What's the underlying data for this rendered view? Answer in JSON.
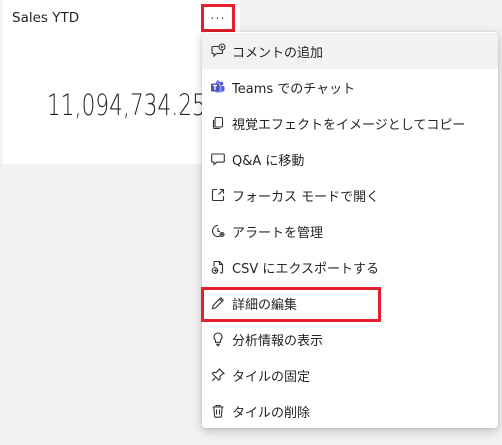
{
  "tile": {
    "title": "Sales YTD",
    "value": "11,094,734.25",
    "more_label": "..."
  },
  "menu": {
    "items": [
      {
        "label": "コメントの追加",
        "icon": "comment-add-icon"
      },
      {
        "label": "Teams でのチャット",
        "icon": "teams-icon"
      },
      {
        "label": "視覚エフェクトをイメージとしてコピー",
        "icon": "copy-icon"
      },
      {
        "label": "Q&A に移動",
        "icon": "chat-bubble-icon"
      },
      {
        "label": "フォーカス モードで開く",
        "icon": "focus-mode-icon"
      },
      {
        "label": "アラートを管理",
        "icon": "alert-manage-icon"
      },
      {
        "label": "CSV にエクスポートする",
        "icon": "export-csv-icon"
      },
      {
        "label": "詳細の編集",
        "icon": "pencil-icon"
      },
      {
        "label": "分析情報の表示",
        "icon": "lightbulb-icon"
      },
      {
        "label": "タイルの固定",
        "icon": "pin-icon"
      },
      {
        "label": "タイルの削除",
        "icon": "trash-icon"
      }
    ]
  },
  "colors": {
    "highlight": "#e61e2d",
    "text": "#252423",
    "icon": "#323130"
  }
}
